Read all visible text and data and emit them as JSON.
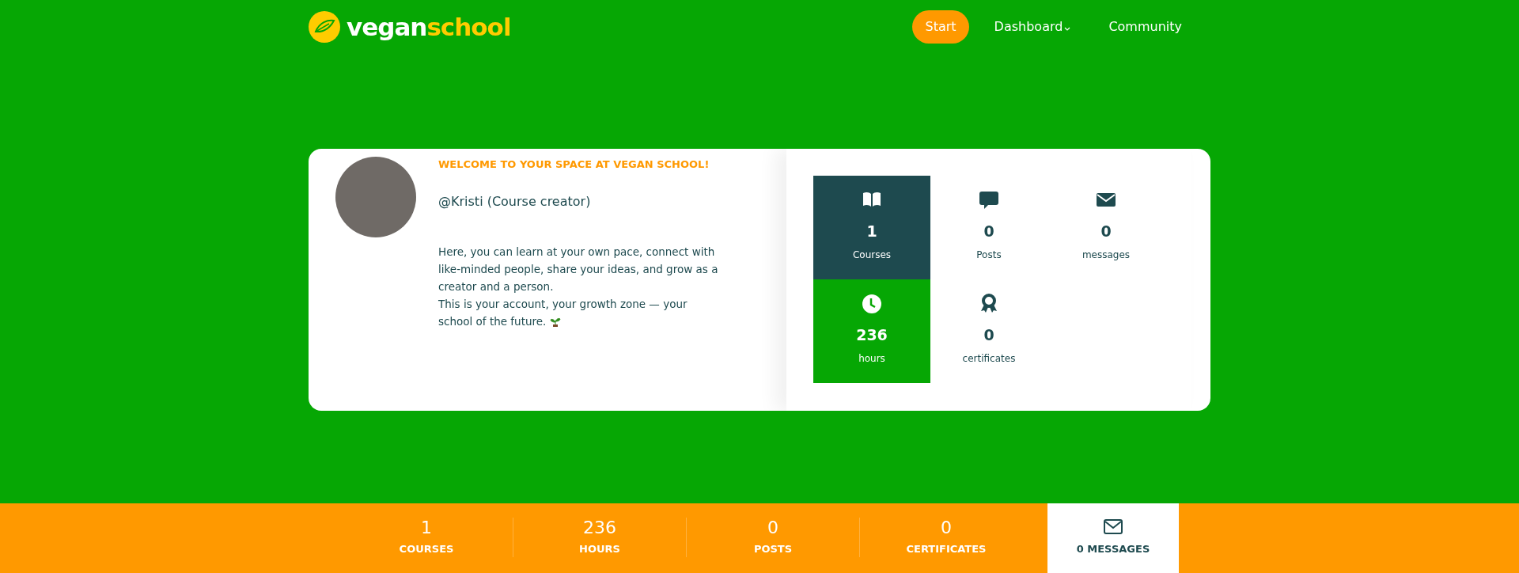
{
  "header": {
    "logo": {
      "text_main": "vegan",
      "text_accent": "school"
    },
    "nav": [
      {
        "label": "Start",
        "selected": true,
        "dropdown": false
      },
      {
        "label": "Dashboard",
        "selected": false,
        "dropdown": true
      },
      {
        "label": "Community",
        "selected": false,
        "dropdown": false
      }
    ]
  },
  "profile": {
    "welcome": "WELCOME TO YOUR SPACE AT VEGAN SCHOOL!",
    "username": "@Kristi (Course creator)",
    "paragraphs": [
      "Here, you can learn at your own pace, connect with like-minded people, share your ideas, and grow as a creator and a person.",
      "This is your account, your growth zone — your school of the future."
    ]
  },
  "stats": [
    {
      "value": "1",
      "label": "Courses",
      "kind": "dark"
    },
    {
      "value": "0",
      "label": "Posts",
      "kind": "plain"
    },
    {
      "value": "0",
      "label": "messages",
      "kind": "plain"
    },
    {
      "value": "236",
      "label": "hours",
      "kind": "green"
    },
    {
      "value": "0",
      "label": "certificates",
      "kind": "plain"
    }
  ],
  "summary_bar": {
    "items": [
      {
        "value": "1",
        "label": "COURSES"
      },
      {
        "value": "236",
        "label": "HOURS"
      },
      {
        "value": "0",
        "label": "POSTS"
      },
      {
        "value": "0",
        "label": "CERTIFICATES"
      }
    ],
    "messages": "0 MESSAGES"
  }
}
